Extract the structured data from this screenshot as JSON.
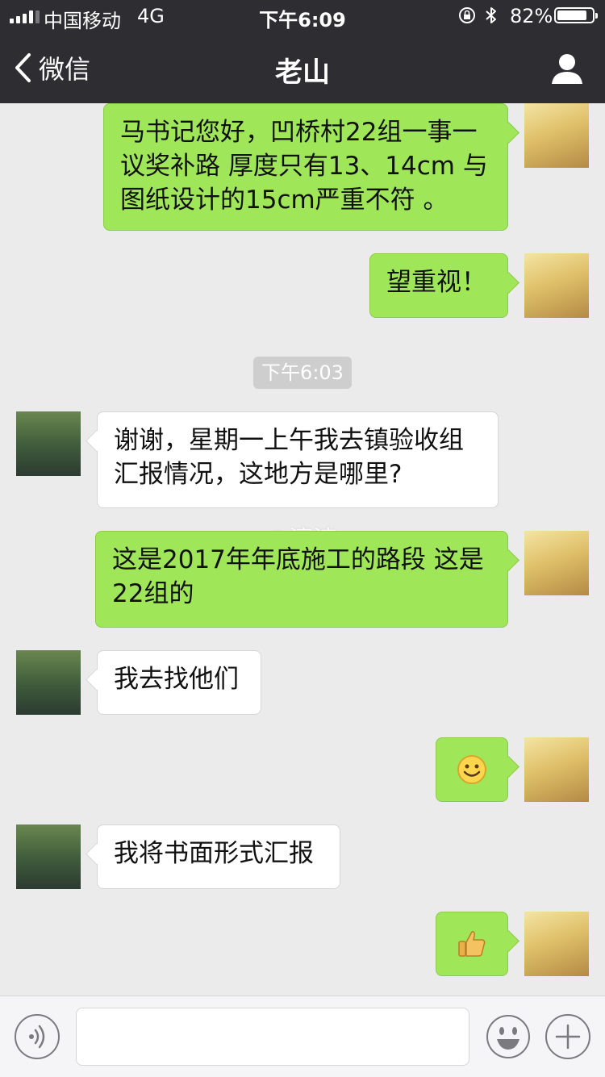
{
  "status_bar": {
    "carrier": "中国移动",
    "network": "4G",
    "time": "下午6:09",
    "battery": "82%",
    "battery_level": 0.82
  },
  "nav": {
    "back_label": "微信",
    "title": "老山"
  },
  "messages": [
    {
      "sender": "me",
      "text": "马书记您好，凹桥村22组一事一议奖补路 厚度只有13、14cm 与图纸设计的15cm严重不符 。"
    },
    {
      "sender": "me",
      "text": "望重视！"
    },
    {
      "sender": "other",
      "text": "谢谢，星期一上午我去镇验收组汇报情况，这地方是哪里?"
    },
    {
      "sender": "me",
      "text": "这是2017年年底施工的路段 这是22组的"
    },
    {
      "sender": "other",
      "text": "我去找他们"
    },
    {
      "sender": "me",
      "emoji": "smile-emoji"
    },
    {
      "sender": "other",
      "text": "我将书面形式汇报"
    },
    {
      "sender": "me",
      "emoji": "thumbs-up-emoji"
    }
  ],
  "timestamp": "下午6:03",
  "watermark": "@濠滨",
  "colors": {
    "header_bg": "#2e2e32",
    "chat_bg": "#ebebeb",
    "my_bubble": "#9fe658",
    "their_bubble": "#ffffff"
  }
}
